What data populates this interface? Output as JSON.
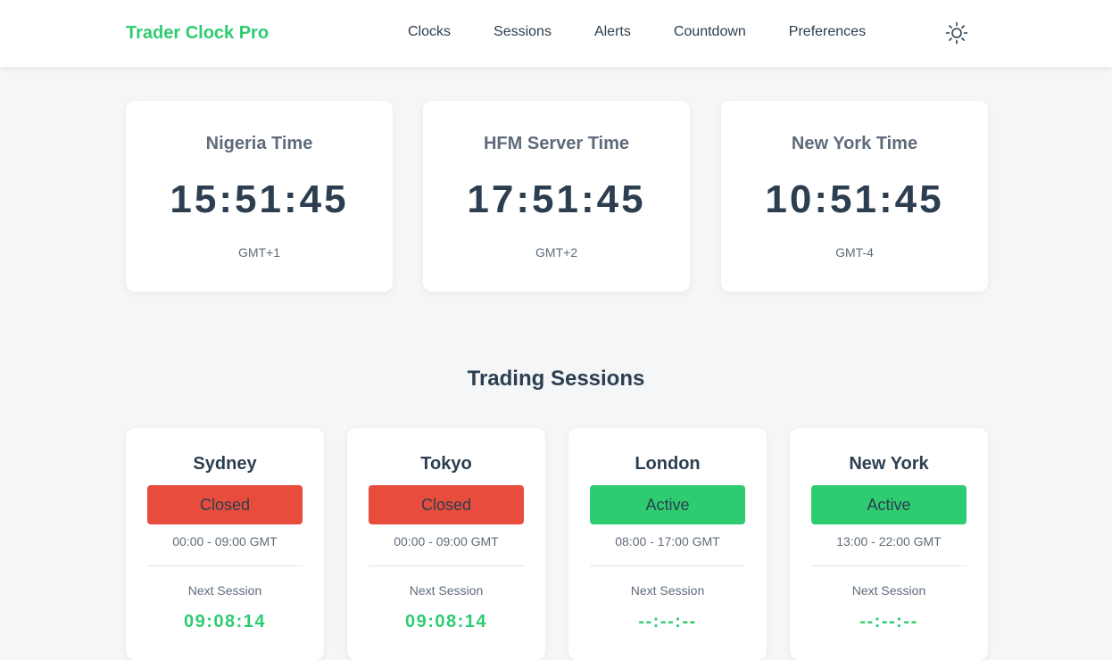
{
  "brand": {
    "name": "Trader Clock Pro",
    "color": "#2ecc71"
  },
  "nav": {
    "items": [
      {
        "label": "Clocks"
      },
      {
        "label": "Sessions"
      },
      {
        "label": "Alerts"
      },
      {
        "label": "Countdown"
      },
      {
        "label": "Preferences"
      }
    ],
    "theme_toggle_icon": "sun-icon"
  },
  "clocks": [
    {
      "title": "Nigeria Time",
      "time": "15:51:45",
      "offset": "GMT+1"
    },
    {
      "title": "HFM Server Time",
      "time": "17:51:45",
      "offset": "GMT+2"
    },
    {
      "title": "New York Time",
      "time": "10:51:45",
      "offset": "GMT-4"
    }
  ],
  "sessions": {
    "title": "Trading Sessions",
    "items": [
      {
        "name": "Sydney",
        "status": "Closed",
        "hours": "00:00 - 09:00 GMT",
        "next_label": "Next Session",
        "countdown": "09:08:14"
      },
      {
        "name": "Tokyo",
        "status": "Closed",
        "hours": "00:00 - 09:00 GMT",
        "next_label": "Next Session",
        "countdown": "09:08:14"
      },
      {
        "name": "London",
        "status": "Active",
        "hours": "08:00 - 17:00 GMT",
        "next_label": "Next Session",
        "countdown": "--:--:--"
      },
      {
        "name": "New York",
        "status": "Active",
        "hours": "13:00 - 22:00 GMT",
        "next_label": "Next Session",
        "countdown": "--:--:--"
      }
    ]
  },
  "colors": {
    "accent": "#2ecc71",
    "closed": "#e74c3c",
    "active": "#2ecc71",
    "text": "#2c3e50",
    "muted": "#5f6b7a",
    "background": "#f4f6f8"
  }
}
